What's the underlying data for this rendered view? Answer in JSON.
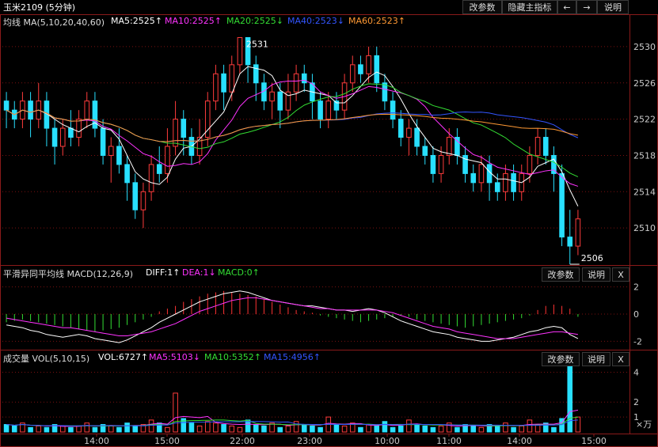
{
  "colors": {
    "up": "#ff3c3c",
    "down": "#28e0ff",
    "text": "#dddddd",
    "grid": "#7a1010",
    "ma5": "#ffffff",
    "ma10": "#ff33ff",
    "ma20": "#33dd33",
    "ma40": "#3355ff",
    "ma60": "#ff9933",
    "diff": "#ffffff",
    "dea": "#ff33ff",
    "macd_up": "#ff3333",
    "macd_down": "#33dd33"
  },
  "top": {
    "title": "玉米2109 (5分钟)",
    "buttons": [
      "改参数",
      "隐藏主指标",
      "←",
      "→",
      "说明"
    ]
  },
  "main": {
    "name": "均线 MA(5,10,20,40,60)",
    "ma5": "MA5:2525↑",
    "ma10": "MA10:2525↑",
    "ma20": "MA20:2525↓",
    "ma40": "MA40:2523↓",
    "ma60": "MA60:2523↑",
    "high_label": "2531",
    "low_label": "2506",
    "y_ticks": [
      "2530",
      "2526",
      "2522",
      "2518",
      "2514",
      "2510"
    ]
  },
  "macd": {
    "name": "平滑异同平均线 MACD(12,26,9)",
    "diff": "DIFF:1↑",
    "dea": "DEA:1↓",
    "macd": "MACD:0↑",
    "buttons": [
      "改参数",
      "说明",
      "X"
    ],
    "y_ticks": [
      "2",
      "0",
      "-2"
    ]
  },
  "vol": {
    "name": "成交量 VOL(5,10,15)",
    "vol": "VOL:6727↑",
    "ma5": "MA5:5103↓",
    "ma10": "MA10:5352↑",
    "ma15": "MA15:4956↑",
    "buttons": [
      "改参数",
      "说明",
      "X"
    ],
    "y_ticks": [
      "4",
      "2",
      "1"
    ],
    "unit": "×万"
  },
  "x_axis": [
    "14:00",
    "15:00",
    "22:00",
    "23:00",
    "10:00",
    "11:00",
    "14:00",
    "15:00"
  ],
  "chart_data": {
    "type": "candlestick",
    "ylim_price": [
      2506,
      2532
    ],
    "candles": [
      [
        2524,
        2523,
        2525,
        2521
      ],
      [
        2523,
        2522,
        2524,
        2521
      ],
      [
        2522,
        2524,
        2525,
        2521
      ],
      [
        2524,
        2522,
        2525,
        2520
      ],
      [
        2522,
        2524,
        2526,
        2521
      ],
      [
        2524,
        2521,
        2525,
        2519
      ],
      [
        2521,
        2519,
        2522,
        2517
      ],
      [
        2519,
        2521,
        2522,
        2518
      ],
      [
        2521,
        2520,
        2523,
        2519
      ],
      [
        2520,
        2522,
        2523,
        2519
      ],
      [
        2522,
        2524,
        2525,
        2521
      ],
      [
        2524,
        2521,
        2525,
        2520
      ],
      [
        2521,
        2518,
        2522,
        2517
      ],
      [
        2518,
        2519,
        2520,
        2515
      ],
      [
        2519,
        2517,
        2521,
        2516
      ],
      [
        2517,
        2515,
        2518,
        2513
      ],
      [
        2515,
        2512,
        2516,
        2511
      ],
      [
        2512,
        2514,
        2515,
        2510
      ],
      [
        2514,
        2517,
        2518,
        2513
      ],
      [
        2517,
        2516,
        2519,
        2515
      ],
      [
        2516,
        2519,
        2521,
        2515
      ],
      [
        2519,
        2522,
        2524,
        2518
      ],
      [
        2522,
        2520,
        2523,
        2518
      ],
      [
        2520,
        2518,
        2521,
        2517
      ],
      [
        2518,
        2520,
        2522,
        2517
      ],
      [
        2520,
        2524,
        2525,
        2519
      ],
      [
        2524,
        2527,
        2528,
        2523
      ],
      [
        2527,
        2525,
        2528,
        2523
      ],
      [
        2525,
        2528,
        2529,
        2524
      ],
      [
        2528,
        2531,
        2531,
        2527
      ],
      [
        2531,
        2528,
        2531,
        2526
      ],
      [
        2528,
        2526,
        2529,
        2524
      ],
      [
        2526,
        2524,
        2527,
        2523
      ],
      [
        2524,
        2525,
        2526,
        2522
      ],
      [
        2525,
        2523,
        2526,
        2521
      ],
      [
        2523,
        2525,
        2527,
        2522
      ],
      [
        2525,
        2527,
        2528,
        2524
      ],
      [
        2527,
        2526,
        2528,
        2525
      ],
      [
        2526,
        2524,
        2527,
        2522
      ],
      [
        2524,
        2522,
        2525,
        2521
      ],
      [
        2522,
        2524,
        2525,
        2521
      ],
      [
        2524,
        2523,
        2525,
        2522
      ],
      [
        2523,
        2526,
        2527,
        2522
      ],
      [
        2526,
        2528,
        2529,
        2525
      ],
      [
        2528,
        2527,
        2529,
        2526
      ],
      [
        2527,
        2529,
        2530,
        2526
      ],
      [
        2529,
        2526,
        2530,
        2525
      ],
      [
        2526,
        2524,
        2527,
        2523
      ],
      [
        2524,
        2522,
        2525,
        2521
      ],
      [
        2522,
        2520,
        2523,
        2519
      ],
      [
        2520,
        2521,
        2522,
        2518
      ],
      [
        2521,
        2519,
        2522,
        2518
      ],
      [
        2519,
        2518,
        2520,
        2517
      ],
      [
        2518,
        2516,
        2519,
        2515
      ],
      [
        2516,
        2518,
        2519,
        2515
      ],
      [
        2518,
        2520,
        2521,
        2517
      ],
      [
        2520,
        2518,
        2521,
        2517
      ],
      [
        2518,
        2516,
        2519,
        2515
      ],
      [
        2516,
        2515,
        2517,
        2514
      ],
      [
        2515,
        2517,
        2518,
        2514
      ],
      [
        2517,
        2515,
        2518,
        2513
      ],
      [
        2515,
        2514,
        2516,
        2513
      ],
      [
        2514,
        2516,
        2517,
        2513
      ],
      [
        2516,
        2514,
        2517,
        2513
      ],
      [
        2514,
        2516,
        2517,
        2513
      ],
      [
        2516,
        2518,
        2519,
        2515
      ],
      [
        2518,
        2520,
        2521,
        2517
      ],
      [
        2520,
        2518,
        2521,
        2517
      ],
      [
        2518,
        2516,
        2519,
        2514
      ],
      [
        2516,
        2509,
        2517,
        2508
      ],
      [
        2509,
        2508,
        2512,
        2506
      ],
      [
        2508,
        2511,
        2512,
        2507
      ]
    ],
    "macd_bars": [
      -0.6,
      -0.5,
      -0.4,
      -0.5,
      -0.6,
      -0.7,
      -0.8,
      -0.9,
      -1.0,
      -1.1,
      -1.2,
      -1.3,
      -1.2,
      -1.1,
      -1.0,
      -0.8,
      -0.6,
      -0.4,
      -0.2,
      0.2,
      0.4,
      0.6,
      0.9,
      1.1,
      1.3,
      1.5,
      1.6,
      1.7,
      1.6,
      1.5,
      1.4,
      1.3,
      1.1,
      0.9,
      0.7,
      0.5,
      0.3,
      0.2,
      0.1,
      -0.1,
      -0.2,
      -0.3,
      -0.4,
      -0.5,
      -0.6,
      -0.5,
      -0.4,
      -0.3,
      -0.2,
      -0.1,
      -0.2,
      -0.4,
      -0.5,
      -0.6,
      -0.7,
      -0.8,
      -0.9,
      -1.0,
      -0.9,
      -0.8,
      -0.7,
      -0.6,
      -0.5,
      -0.4,
      -0.3,
      -0.1,
      0.3,
      0.6,
      0.7,
      0.6,
      0.4,
      -0.2
    ],
    "diff": [
      -0.8,
      -0.9,
      -1.0,
      -1.2,
      -1.3,
      -1.5,
      -1.6,
      -1.7,
      -1.6,
      -1.5,
      -1.6,
      -1.8,
      -1.9,
      -2.0,
      -2.1,
      -1.9,
      -1.6,
      -1.3,
      -1.0,
      -0.6,
      -0.3,
      0.0,
      0.3,
      0.6,
      0.9,
      1.1,
      1.3,
      1.5,
      1.6,
      1.7,
      1.6,
      1.4,
      1.2,
      1.0,
      0.9,
      0.8,
      0.7,
      0.6,
      0.6,
      0.5,
      0.4,
      0.3,
      0.3,
      0.2,
      0.3,
      0.4,
      0.3,
      0.1,
      -0.2,
      -0.5,
      -0.7,
      -0.9,
      -1.1,
      -1.3,
      -1.4,
      -1.5,
      -1.7,
      -1.8,
      -1.9,
      -2.0,
      -2.0,
      -1.9,
      -1.8,
      -1.7,
      -1.5,
      -1.3,
      -1.2,
      -1.0,
      -0.9,
      -1.0,
      -1.5,
      -1.8
    ],
    "dea": [
      -0.3,
      -0.4,
      -0.5,
      -0.6,
      -0.7,
      -0.8,
      -0.9,
      -1.0,
      -1.0,
      -1.1,
      -1.2,
      -1.3,
      -1.4,
      -1.5,
      -1.6,
      -1.6,
      -1.5,
      -1.4,
      -1.3,
      -1.1,
      -0.9,
      -0.7,
      -0.4,
      -0.1,
      0.2,
      0.4,
      0.6,
      0.8,
      1.0,
      1.1,
      1.2,
      1.2,
      1.1,
      1.0,
      0.9,
      0.8,
      0.7,
      0.6,
      0.5,
      0.4,
      0.4,
      0.3,
      0.3,
      0.3,
      0.3,
      0.3,
      0.3,
      0.2,
      0.1,
      -0.1,
      -0.3,
      -0.5,
      -0.7,
      -0.9,
      -1.0,
      -1.1,
      -1.3,
      -1.4,
      -1.5,
      -1.6,
      -1.7,
      -1.8,
      -1.8,
      -1.8,
      -1.7,
      -1.6,
      -1.5,
      -1.4,
      -1.3,
      -1.3,
      -1.4,
      -1.5
    ],
    "volume": [
      0.5,
      0.4,
      0.6,
      0.3,
      0.4,
      0.3,
      0.5,
      0.4,
      0.3,
      0.4,
      0.6,
      0.3,
      0.5,
      0.4,
      0.3,
      0.6,
      0.4,
      0.5,
      0.8,
      0.6,
      0.3,
      2.6,
      0.9,
      0.6,
      0.4,
      0.7,
      0.6,
      0.5,
      0.4,
      0.3,
      0.8,
      0.5,
      0.4,
      0.6,
      0.3,
      0.4,
      0.7,
      0.5,
      0.4,
      0.3,
      1.0,
      0.5,
      0.4,
      0.6,
      0.3,
      0.5,
      0.4,
      0.7,
      0.3,
      0.4,
      0.8,
      0.5,
      0.4,
      0.3,
      0.4,
      0.6,
      0.3,
      0.5,
      0.4,
      0.3,
      0.5,
      0.4,
      0.6,
      0.3,
      0.4,
      0.8,
      0.5,
      0.6,
      0.3,
      0.9,
      4.5,
      1.0
    ],
    "vol_ylim": [
      0,
      4.5
    ]
  }
}
